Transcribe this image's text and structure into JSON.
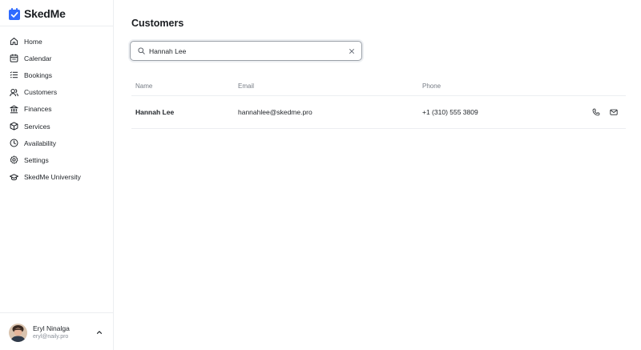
{
  "app": {
    "name": "SkedMe",
    "brand_color": "#2f6bff"
  },
  "sidebar": {
    "items": [
      {
        "label": "Home",
        "icon": "home-icon"
      },
      {
        "label": "Calendar",
        "icon": "calendar-icon"
      },
      {
        "label": "Bookings",
        "icon": "list-icon"
      },
      {
        "label": "Customers",
        "icon": "users-icon"
      },
      {
        "label": "Finances",
        "icon": "bank-icon"
      },
      {
        "label": "Services",
        "icon": "box-icon"
      },
      {
        "label": "Availability",
        "icon": "clock-icon"
      },
      {
        "label": "Settings",
        "icon": "gear-icon"
      },
      {
        "label": "SkedMe University",
        "icon": "graduation-cap-icon"
      }
    ],
    "user": {
      "name": "Eryl Ninalga",
      "email": "eryl@naily.pro"
    }
  },
  "main": {
    "title": "Customers",
    "search": {
      "value": "Hannah Lee"
    },
    "table": {
      "columns": [
        "Name",
        "Email",
        "Phone"
      ],
      "rows": [
        {
          "name": "Hannah Lee",
          "email": "hannahlee@skedme.pro",
          "phone": "+1 (310) 555 3809"
        }
      ]
    }
  }
}
